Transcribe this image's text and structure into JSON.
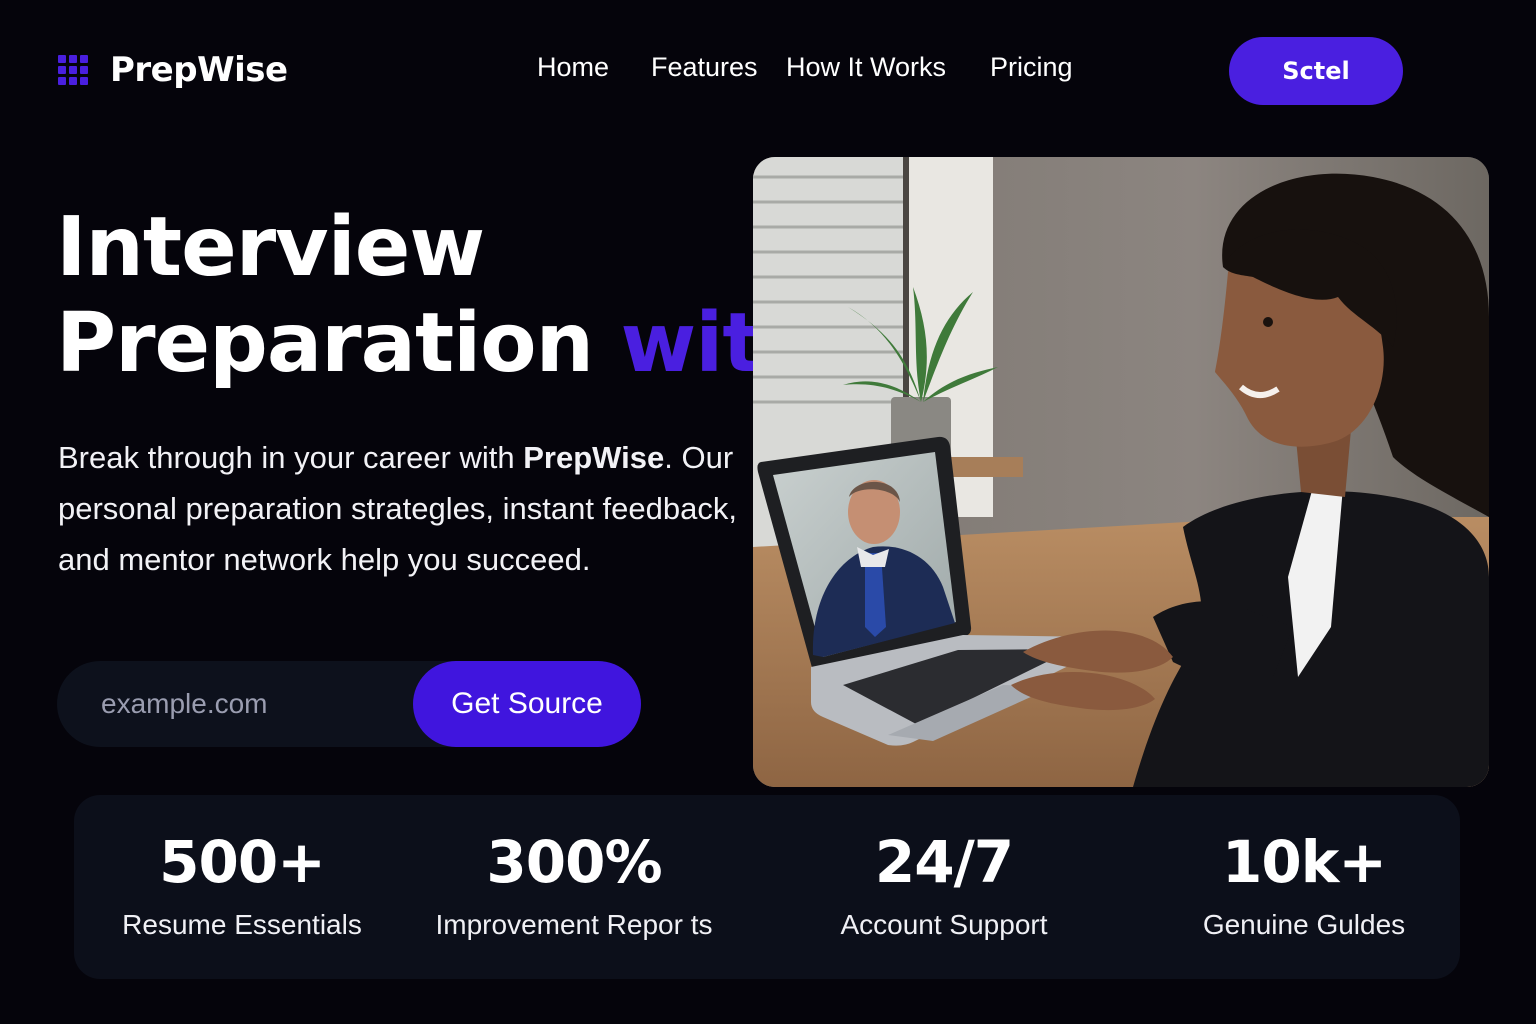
{
  "brand": {
    "name": "PrepWise",
    "accent_color": "#4a1fe0"
  },
  "nav": {
    "links": [
      "Home",
      "Features",
      "How It Works",
      "Pricing"
    ],
    "cta_label": "Sctel"
  },
  "hero": {
    "title_line1": "Interview",
    "title_line2": "Preparation",
    "title_accent": "with",
    "desc_before": "Break through in your career with ",
    "desc_brand": "PrepWise",
    "desc_after": ". Our personal preparation strategles, instant feedback, and mentor network help you succeed.",
    "input_placeholder": "example.com",
    "submit_label": "Get Source"
  },
  "stats": [
    {
      "value": "500+",
      "label": "Resume Essentials"
    },
    {
      "value": "300%",
      "label": "Improvement Repor ts"
    },
    {
      "value": "24/7",
      "label": "Account Support"
    },
    {
      "value": "10k+",
      "label": "Genuine Guldes"
    }
  ]
}
